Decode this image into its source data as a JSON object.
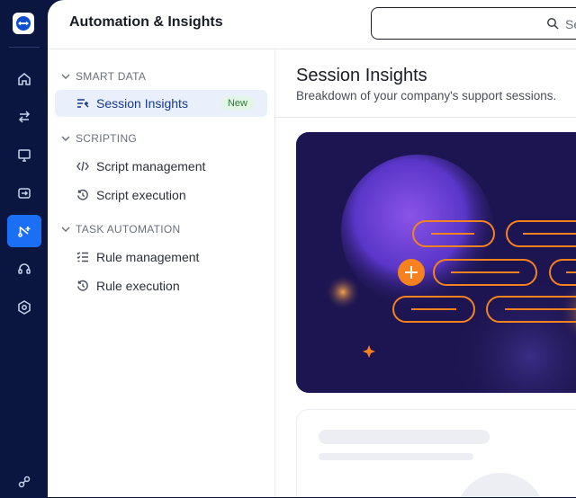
{
  "rail": {
    "items": [
      {
        "icon": "home-icon"
      },
      {
        "icon": "transfer-icon"
      },
      {
        "icon": "devices-icon"
      },
      {
        "icon": "sessions-icon"
      },
      {
        "icon": "automation-icon",
        "active": true
      },
      {
        "icon": "support-headset-icon"
      },
      {
        "icon": "settings-hex-icon"
      }
    ],
    "bottom_icon": "integrations-icon"
  },
  "header": {
    "title": "Automation & Insights",
    "search_placeholder": "Se"
  },
  "sidebar": {
    "sections": [
      {
        "label": "SMART DATA",
        "items": [
          {
            "label": "Session Insights",
            "badge": "New",
            "icon": "insights-icon",
            "active": true
          }
        ]
      },
      {
        "label": "SCRIPTING",
        "items": [
          {
            "label": "Script management",
            "icon": "code-icon"
          },
          {
            "label": "Script execution",
            "icon": "history-icon"
          }
        ]
      },
      {
        "label": "TASK AUTOMATION",
        "items": [
          {
            "label": "Rule management",
            "icon": "checklist-icon"
          },
          {
            "label": "Rule execution",
            "icon": "history-icon"
          }
        ]
      }
    ]
  },
  "content": {
    "title": "Session Insights",
    "subtitle": "Breakdown of your company's support sessions.",
    "hero_accent": "#f5821f",
    "hero_background": "#1d1551"
  }
}
